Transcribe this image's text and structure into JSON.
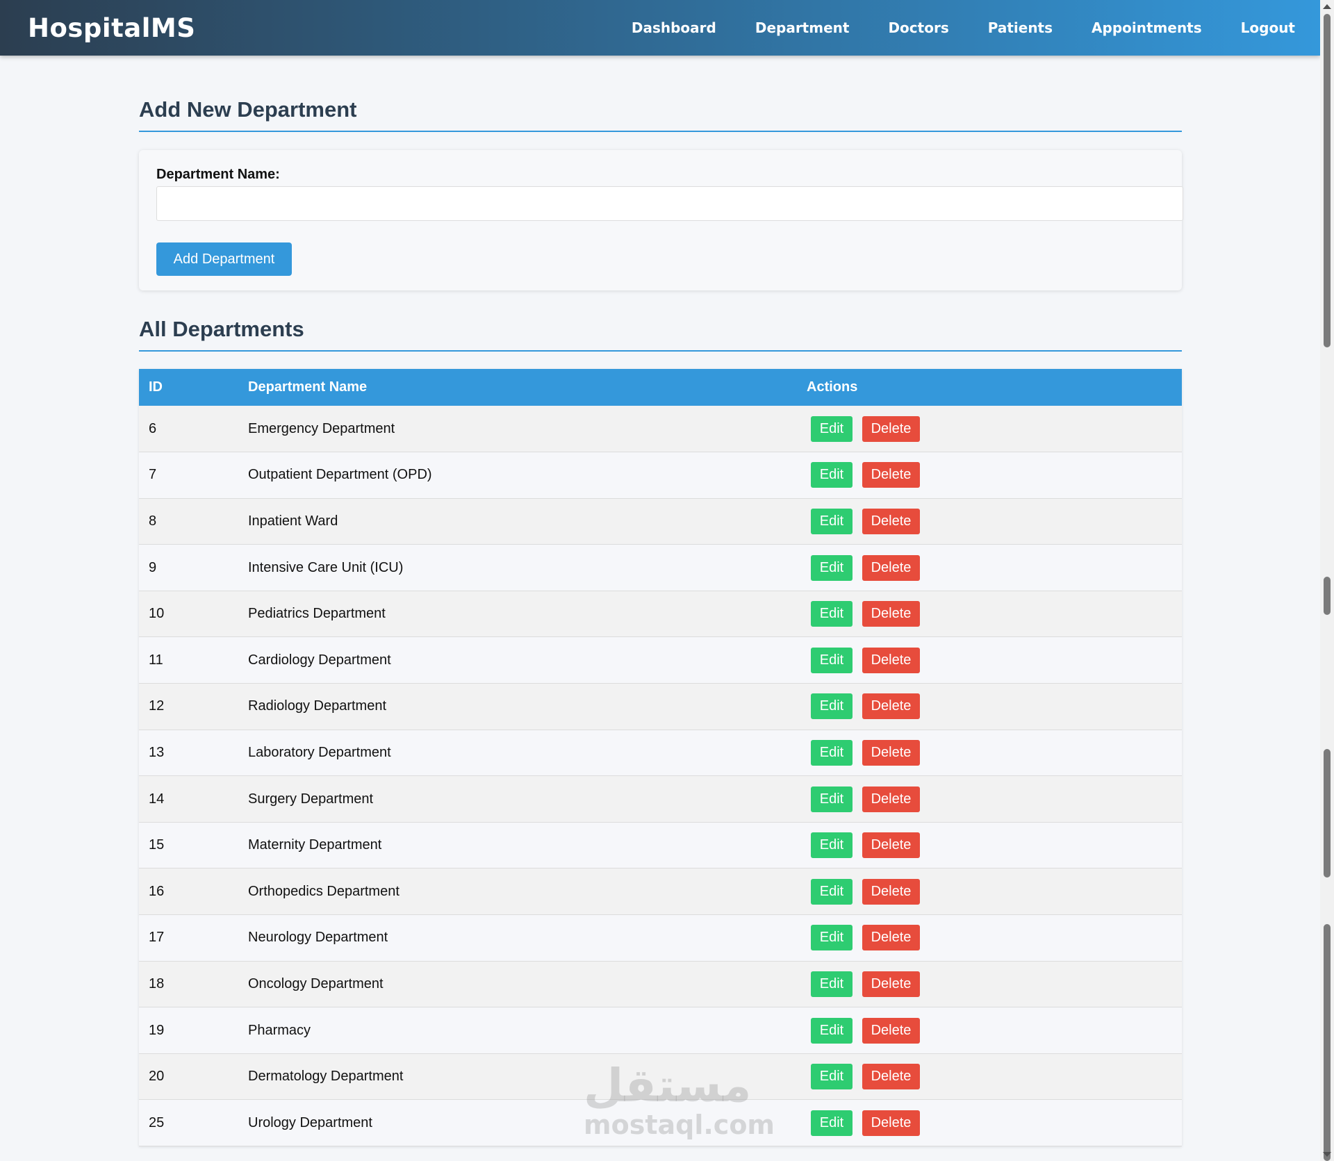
{
  "navbar": {
    "brand": "HospitalMS",
    "links": [
      {
        "label": "Dashboard",
        "name": "nav-dashboard"
      },
      {
        "label": "Department",
        "name": "nav-department"
      },
      {
        "label": "Doctors",
        "name": "nav-doctors"
      },
      {
        "label": "Patients",
        "name": "nav-patients"
      },
      {
        "label": "Appointments",
        "name": "nav-appointments"
      },
      {
        "label": "Logout",
        "name": "nav-logout"
      }
    ]
  },
  "add_section": {
    "title": "Add New Department",
    "label": "Department Name:",
    "input_value": "",
    "button_label": "Add Department"
  },
  "list_section": {
    "title": "All Departments",
    "columns": [
      "ID",
      "Department Name",
      "Actions"
    ],
    "edit_label": "Edit",
    "delete_label": "Delete",
    "rows": [
      {
        "id": "6",
        "name": "Emergency Department"
      },
      {
        "id": "7",
        "name": "Outpatient Department (OPD)"
      },
      {
        "id": "8",
        "name": "Inpatient Ward"
      },
      {
        "id": "9",
        "name": "Intensive Care Unit (ICU)"
      },
      {
        "id": "10",
        "name": "Pediatrics Department"
      },
      {
        "id": "11",
        "name": "Cardiology Department"
      },
      {
        "id": "12",
        "name": "Radiology Department"
      },
      {
        "id": "13",
        "name": "Laboratory Department"
      },
      {
        "id": "14",
        "name": "Surgery Department"
      },
      {
        "id": "15",
        "name": "Maternity Department"
      },
      {
        "id": "16",
        "name": "Orthopedics Department"
      },
      {
        "id": "17",
        "name": "Neurology Department"
      },
      {
        "id": "18",
        "name": "Oncology Department"
      },
      {
        "id": "19",
        "name": "Pharmacy"
      },
      {
        "id": "20",
        "name": "Dermatology Department"
      },
      {
        "id": "25",
        "name": "Urology Department"
      }
    ]
  },
  "watermark": {
    "arabic": "مستقل",
    "latin": "mostaql.com"
  },
  "colors": {
    "primary": "#3498db",
    "navbar_start": "#2c3e50",
    "edit": "#2ecc71",
    "delete": "#e74c3c",
    "background": "#f4f6f9"
  }
}
